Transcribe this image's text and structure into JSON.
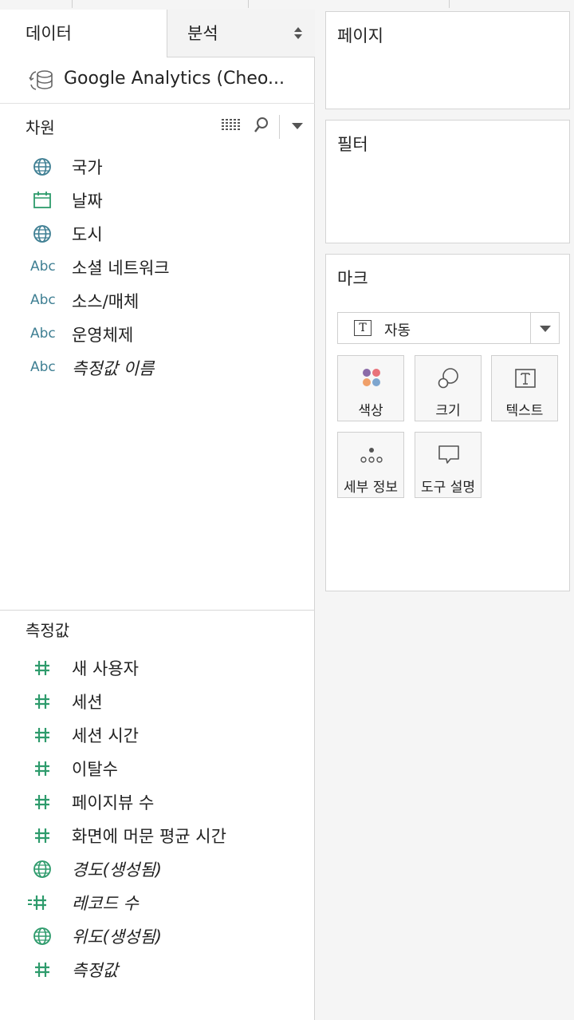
{
  "tabs": {
    "data": "데이터",
    "analysis": "분석"
  },
  "datasource": {
    "name": "Google Analytics (Cheo..."
  },
  "dimensions": {
    "header": "차원",
    "items": [
      {
        "label": "국가",
        "icon": "globe-icon",
        "italic": false
      },
      {
        "label": "날짜",
        "icon": "calendar-icon",
        "italic": false
      },
      {
        "label": "도시",
        "icon": "globe-icon",
        "italic": false
      },
      {
        "label": "소셜 네트워크",
        "icon": "Abc",
        "italic": false
      },
      {
        "label": "소스/매체",
        "icon": "Abc",
        "italic": false
      },
      {
        "label": "운영체제",
        "icon": "Abc",
        "italic": false
      },
      {
        "label": "측정값 이름",
        "icon": "Abc",
        "italic": true
      }
    ]
  },
  "measures": {
    "header": "측정값",
    "items": [
      {
        "label": "새 사용자",
        "icon": "hash-icon",
        "italic": false
      },
      {
        "label": "세션",
        "icon": "hash-icon",
        "italic": false
      },
      {
        "label": "세션 시간",
        "icon": "hash-icon",
        "italic": false
      },
      {
        "label": "이탈수",
        "icon": "hash-icon",
        "italic": false
      },
      {
        "label": "페이지뷰 수",
        "icon": "hash-icon",
        "italic": false
      },
      {
        "label": "화면에 머문 평균 시간",
        "icon": "hash-icon",
        "italic": false
      },
      {
        "label": "경도(생성됨)",
        "icon": "globe-icon",
        "italic": true
      },
      {
        "label": "레코드 수",
        "icon": "record-hash-icon",
        "italic": true
      },
      {
        "label": "위도(생성됨)",
        "icon": "globe-icon",
        "italic": true
      },
      {
        "label": "측정값",
        "icon": "hash-icon",
        "italic": true
      }
    ]
  },
  "shelves": {
    "pages": "페이지",
    "filters": "필터",
    "marks": "마크"
  },
  "marks": {
    "type_icon": "T",
    "type": "자동",
    "cards": {
      "color": "색상",
      "size": "크기",
      "text": "텍스트",
      "detail": "세부 정보",
      "tooltip": "도구 설명"
    }
  },
  "colors": {
    "dimension_icon": "#3f7f93",
    "measure_icon": "#2e9b6c",
    "dot_purple": "#8b6ba8",
    "dot_red": "#e8727a",
    "dot_orange": "#f0a06a",
    "dot_blue": "#7ea6cf"
  }
}
